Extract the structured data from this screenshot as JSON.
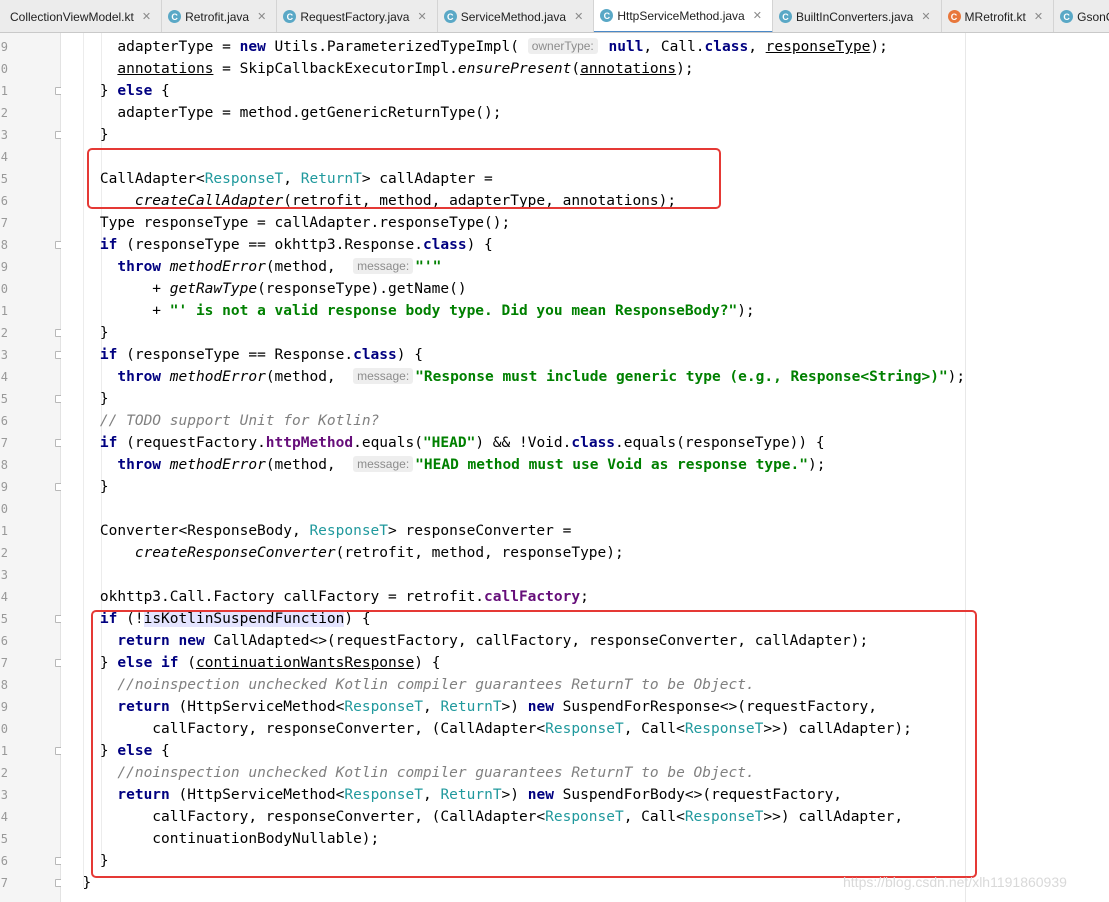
{
  "tabs": [
    {
      "label": "CollectionViewModel.kt",
      "icon": "kotlin-file-icon",
      "color": "#7f6fd6",
      "glyph": "",
      "closable": true,
      "active": false
    },
    {
      "label": "Retrofit.java",
      "icon": "class-file-icon",
      "color": "#5aa8c6",
      "glyph": "C",
      "closable": true,
      "active": false
    },
    {
      "label": "RequestFactory.java",
      "icon": "class-file-icon",
      "color": "#5aa8c6",
      "glyph": "C",
      "closable": true,
      "active": false
    },
    {
      "label": "ServiceMethod.java",
      "icon": "class-file-icon",
      "color": "#5aa8c6",
      "glyph": "C",
      "closable": true,
      "active": false
    },
    {
      "label": "HttpServiceMethod.java",
      "icon": "class-file-icon",
      "color": "#5aa8c6",
      "glyph": "C",
      "closable": true,
      "active": true
    },
    {
      "label": "BuiltInConverters.java",
      "icon": "class-file-icon",
      "color": "#5aa8c6",
      "glyph": "C",
      "closable": true,
      "active": false
    },
    {
      "label": "MRetrofit.kt",
      "icon": "kotlin-class-icon",
      "color": "#e8773b",
      "glyph": "C",
      "closable": true,
      "active": false
    },
    {
      "label": "GsonConverte",
      "icon": "class-file-icon",
      "color": "#5aa8c6",
      "glyph": "C",
      "closable": false,
      "active": false
    }
  ],
  "line_numbers": [
    "9",
    "0",
    "1",
    "2",
    "3",
    "4",
    "5",
    "6",
    "7",
    "8",
    "9",
    "0",
    "1",
    "2",
    "3",
    "4",
    "5",
    "6",
    "7",
    "8",
    "9",
    "0",
    "1",
    "2",
    "3",
    "4",
    "5",
    "6",
    "7",
    "8",
    "9",
    "0",
    "1",
    "2",
    "3",
    "4",
    "5",
    "6",
    "7"
  ],
  "code_lines": [
    [
      {
        "t": "      adapterType = "
      },
      {
        "t": "new",
        "c": "kw"
      },
      {
        "t": " Utils.ParameterizedTypeImpl( "
      },
      {
        "t": "ownerType:",
        "c": "hint"
      },
      {
        "t": " "
      },
      {
        "t": "null",
        "c": "kw"
      },
      {
        "t": ", Call."
      },
      {
        "t": "class",
        "c": "kw"
      },
      {
        "t": ", "
      },
      {
        "t": "responseType",
        "c": "und"
      },
      {
        "t": ");"
      }
    ],
    [
      {
        "t": "      "
      },
      {
        "t": "annotations",
        "c": "und"
      },
      {
        "t": " = SkipCallbackExecutorImpl."
      },
      {
        "t": "ensurePresent",
        "c": "itl"
      },
      {
        "t": "("
      },
      {
        "t": "annotations",
        "c": "und"
      },
      {
        "t": ");"
      }
    ],
    [
      {
        "t": "    } "
      },
      {
        "t": "else",
        "c": "kw"
      },
      {
        "t": " {"
      }
    ],
    [
      {
        "t": "      adapterType = method.getGenericReturnType();"
      }
    ],
    [
      {
        "t": "    }"
      }
    ],
    [
      {
        "t": ""
      }
    ],
    [
      {
        "t": "    CallAdapter<"
      },
      {
        "t": "ResponseT",
        "c": "tp"
      },
      {
        "t": ", "
      },
      {
        "t": "ReturnT",
        "c": "tp"
      },
      {
        "t": "> callAdapter ="
      }
    ],
    [
      {
        "t": "        "
      },
      {
        "t": "createCallAdapter",
        "c": "itl"
      },
      {
        "t": "(retrofit, method, adapterType, annotations);"
      }
    ],
    [
      {
        "t": "    Type responseType = callAdapter.responseType();"
      }
    ],
    [
      {
        "t": "    "
      },
      {
        "t": "if",
        "c": "kw"
      },
      {
        "t": " (responseType == okhttp3.Response."
      },
      {
        "t": "class",
        "c": "kw"
      },
      {
        "t": ") {"
      }
    ],
    [
      {
        "t": "      "
      },
      {
        "t": "throw",
        "c": "kw"
      },
      {
        "t": " "
      },
      {
        "t": "methodError",
        "c": "itl"
      },
      {
        "t": "(method,  "
      },
      {
        "t": "message:",
        "c": "hint"
      },
      {
        "t": "\"'\"",
        "c": "str"
      }
    ],
    [
      {
        "t": "          + "
      },
      {
        "t": "getRawType",
        "c": "itl"
      },
      {
        "t": "(responseType).getName()"
      }
    ],
    [
      {
        "t": "          + "
      },
      {
        "t": "\"' is not a valid response body type. Did you mean ResponseBody?\"",
        "c": "str"
      },
      {
        "t": ");"
      }
    ],
    [
      {
        "t": "    }"
      }
    ],
    [
      {
        "t": "    "
      },
      {
        "t": "if",
        "c": "kw"
      },
      {
        "t": " (responseType == Response."
      },
      {
        "t": "class",
        "c": "kw"
      },
      {
        "t": ") {"
      }
    ],
    [
      {
        "t": "      "
      },
      {
        "t": "throw",
        "c": "kw"
      },
      {
        "t": " "
      },
      {
        "t": "methodError",
        "c": "itl"
      },
      {
        "t": "(method,  "
      },
      {
        "t": "message:",
        "c": "hint"
      },
      {
        "t": "\"Response must include generic type (e.g., Response<String>)\"",
        "c": "str"
      },
      {
        "t": ");"
      }
    ],
    [
      {
        "t": "    }"
      }
    ],
    [
      {
        "t": "    "
      },
      {
        "t": "// TODO support Unit for Kotlin?",
        "c": "cmt"
      }
    ],
    [
      {
        "t": "    "
      },
      {
        "t": "if",
        "c": "kw"
      },
      {
        "t": " (requestFactory."
      },
      {
        "t": "httpMethod",
        "c": "fld"
      },
      {
        "t": ".equals("
      },
      {
        "t": "\"HEAD\"",
        "c": "str"
      },
      {
        "t": ") && !Void."
      },
      {
        "t": "class",
        "c": "kw"
      },
      {
        "t": ".equals(responseType)) {"
      }
    ],
    [
      {
        "t": "      "
      },
      {
        "t": "throw",
        "c": "kw"
      },
      {
        "t": " "
      },
      {
        "t": "methodError",
        "c": "itl"
      },
      {
        "t": "(method,  "
      },
      {
        "t": "message:",
        "c": "hint"
      },
      {
        "t": "\"HEAD method must use Void as response type.\"",
        "c": "str"
      },
      {
        "t": ");"
      }
    ],
    [
      {
        "t": "    }"
      }
    ],
    [
      {
        "t": ""
      }
    ],
    [
      {
        "t": "    Converter<ResponseBody, "
      },
      {
        "t": "ResponseT",
        "c": "tp"
      },
      {
        "t": "> responseConverter ="
      }
    ],
    [
      {
        "t": "        "
      },
      {
        "t": "createResponseConverter",
        "c": "itl"
      },
      {
        "t": "(retrofit, method, responseType);"
      }
    ],
    [
      {
        "t": ""
      }
    ],
    [
      {
        "t": "    okhttp3.Call.Factory callFactory = retrofit."
      },
      {
        "t": "callFactory",
        "c": "fld"
      },
      {
        "t": ";"
      }
    ],
    [
      {
        "t": "    "
      },
      {
        "t": "if",
        "c": "kw"
      },
      {
        "t": " (!"
      },
      {
        "t": "isKotlinSuspendFunction",
        "c": "hl"
      },
      {
        "t": ") {"
      }
    ],
    [
      {
        "t": "      "
      },
      {
        "t": "return",
        "c": "kw"
      },
      {
        "t": " "
      },
      {
        "t": "new",
        "c": "kw"
      },
      {
        "t": " CallAdapted<>(requestFactory, callFactory, responseConverter, callAdapter);"
      }
    ],
    [
      {
        "t": "    } "
      },
      {
        "t": "else",
        "c": "kw"
      },
      {
        "t": " "
      },
      {
        "t": "if",
        "c": "kw"
      },
      {
        "t": " ("
      },
      {
        "t": "continuationWantsResponse",
        "c": "und"
      },
      {
        "t": ") {"
      }
    ],
    [
      {
        "t": "      "
      },
      {
        "t": "//noinspection unchecked Kotlin compiler guarantees ReturnT to be Object.",
        "c": "cmt"
      }
    ],
    [
      {
        "t": "      "
      },
      {
        "t": "return",
        "c": "kw"
      },
      {
        "t": " (HttpServiceMethod<"
      },
      {
        "t": "ResponseT",
        "c": "tp"
      },
      {
        "t": ", "
      },
      {
        "t": "ReturnT",
        "c": "tp"
      },
      {
        "t": ">) "
      },
      {
        "t": "new",
        "c": "kw"
      },
      {
        "t": " SuspendForResponse<>(requestFactory,"
      }
    ],
    [
      {
        "t": "          callFactory, responseConverter, (CallAdapter<"
      },
      {
        "t": "ResponseT",
        "c": "tp"
      },
      {
        "t": ", Call<"
      },
      {
        "t": "ResponseT",
        "c": "tp"
      },
      {
        "t": ">>) callAdapter);"
      }
    ],
    [
      {
        "t": "    } "
      },
      {
        "t": "else",
        "c": "kw"
      },
      {
        "t": " {"
      }
    ],
    [
      {
        "t": "      "
      },
      {
        "t": "//noinspection unchecked Kotlin compiler guarantees ReturnT to be Object.",
        "c": "cmt"
      }
    ],
    [
      {
        "t": "      "
      },
      {
        "t": "return",
        "c": "kw"
      },
      {
        "t": " (HttpServiceMethod<"
      },
      {
        "t": "ResponseT",
        "c": "tp"
      },
      {
        "t": ", "
      },
      {
        "t": "ReturnT",
        "c": "tp"
      },
      {
        "t": ">) "
      },
      {
        "t": "new",
        "c": "kw"
      },
      {
        "t": " SuspendForBody<>(requestFactory,"
      }
    ],
    [
      {
        "t": "          callFactory, responseConverter, (CallAdapter<"
      },
      {
        "t": "ResponseT",
        "c": "tp"
      },
      {
        "t": ", Call<"
      },
      {
        "t": "ResponseT",
        "c": "tp"
      },
      {
        "t": ">>) callAdapter,"
      }
    ],
    [
      {
        "t": "          continuationBodyNullable);"
      }
    ],
    [
      {
        "t": "    }"
      }
    ],
    [
      {
        "t": "  }"
      }
    ]
  ],
  "highlight_color": "#e53935",
  "watermark": "https://blog.csdn.net/xlh1191860939"
}
